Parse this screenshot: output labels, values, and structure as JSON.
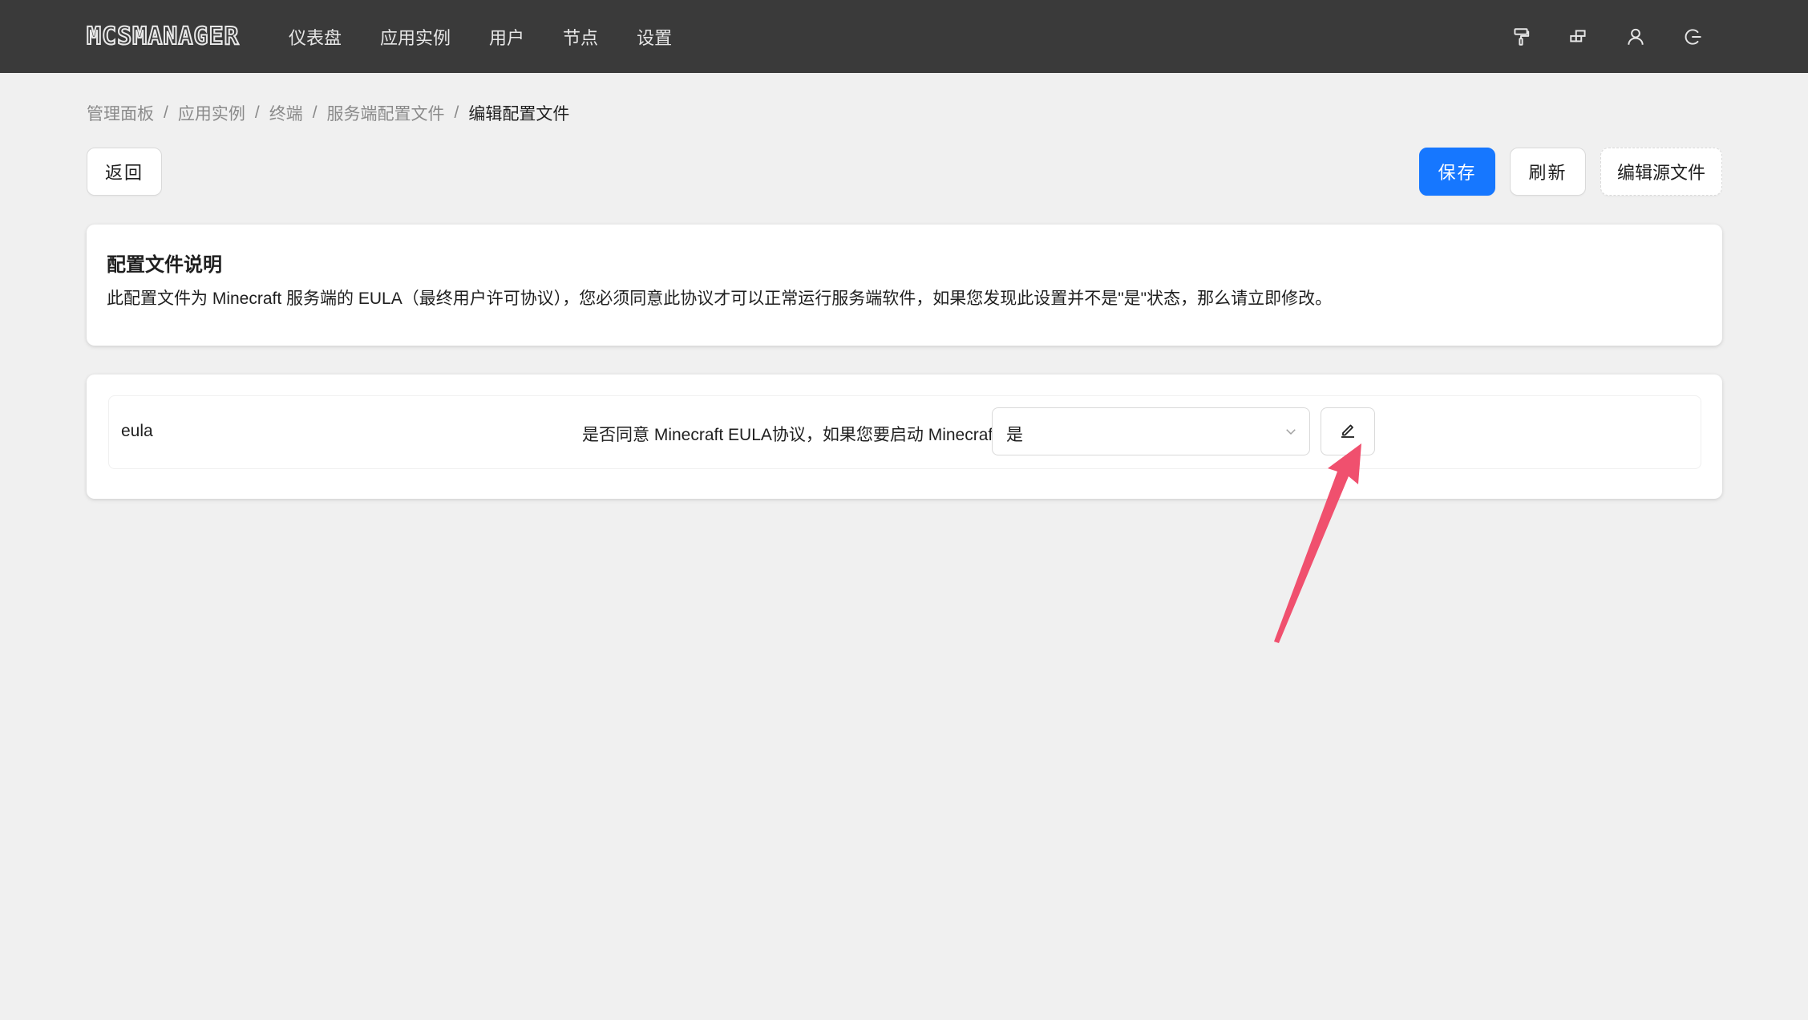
{
  "app": {
    "logo_text": "MCSMANAGER"
  },
  "nav": {
    "items": [
      {
        "label": "仪表盘"
      },
      {
        "label": "应用实例"
      },
      {
        "label": "用户"
      },
      {
        "label": "节点"
      },
      {
        "label": "设置"
      }
    ],
    "icons": [
      "paint-roller-icon",
      "layout-icon",
      "user-icon",
      "logout-icon"
    ]
  },
  "breadcrumb": {
    "items": [
      "管理面板",
      "应用实例",
      "终端",
      "服务端配置文件"
    ],
    "current": "编辑配置文件",
    "separator": "/"
  },
  "toolbar": {
    "back_label": "返回",
    "save_label": "保存",
    "refresh_label": "刷新",
    "edit_source_label": "编辑源文件"
  },
  "description": {
    "title": "配置文件说明",
    "text": "此配置文件为 Minecraft 服务端的 EULA（最终用户许可协议），您必须同意此协议才可以正常运行服务端软件，如果您发现此设置并不是\"是\"状态，那么请立即修改。"
  },
  "config": {
    "rows": [
      {
        "key": "eula",
        "description": "是否同意 Minecraft EULA协议，如果您要启动 Minecraft 服务器，则此选项是必须开启",
        "value": "是"
      }
    ]
  },
  "colors": {
    "topbar": "#3a3a3a",
    "primary": "#1677ff",
    "background": "#f0f0f0",
    "annotation_arrow": "#f0506e"
  }
}
